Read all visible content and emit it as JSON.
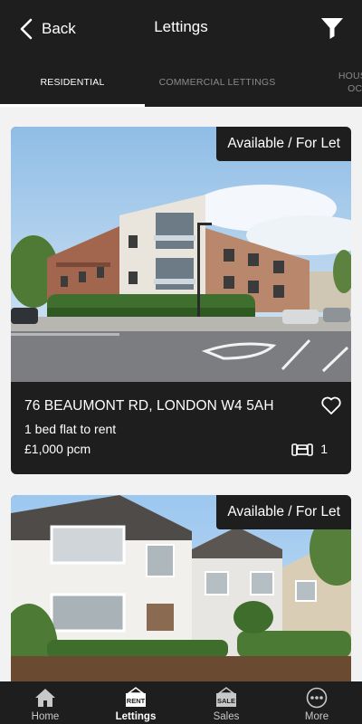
{
  "header": {
    "back_label": "Back",
    "title": "Lettings"
  },
  "tabs": [
    {
      "label": "RESIDENTIAL",
      "active": true
    },
    {
      "label": "COMMERCIAL LETTINGS",
      "active": false
    },
    {
      "label": "HOUSE IN MULTIPLE OCCUPATION",
      "line1": "HOUSE IN",
      "line2": "OCCU",
      "active": false
    }
  ],
  "listings": [
    {
      "status": "Available / For Let",
      "address": "76 BEAUMONT RD, LONDON W4 5AH",
      "description": "1 bed flat to rent",
      "price": "£1,000 pcm",
      "bedrooms": "1"
    },
    {
      "status": "Available / For Let"
    }
  ],
  "bottom_nav": [
    {
      "label": "Home",
      "icon": "home-icon"
    },
    {
      "label": "Lettings",
      "icon": "rent-sign-icon",
      "active": true,
      "icon_text": "RENT"
    },
    {
      "label": "Sales",
      "icon": "sale-sign-icon",
      "icon_text": "SALE"
    },
    {
      "label": "More",
      "icon": "more-icon"
    }
  ],
  "colors": {
    "bar": "#1e1e1e",
    "page_bg": "#f2f2f2",
    "text": "#ffffff",
    "inactive": "#8a8a8a"
  }
}
